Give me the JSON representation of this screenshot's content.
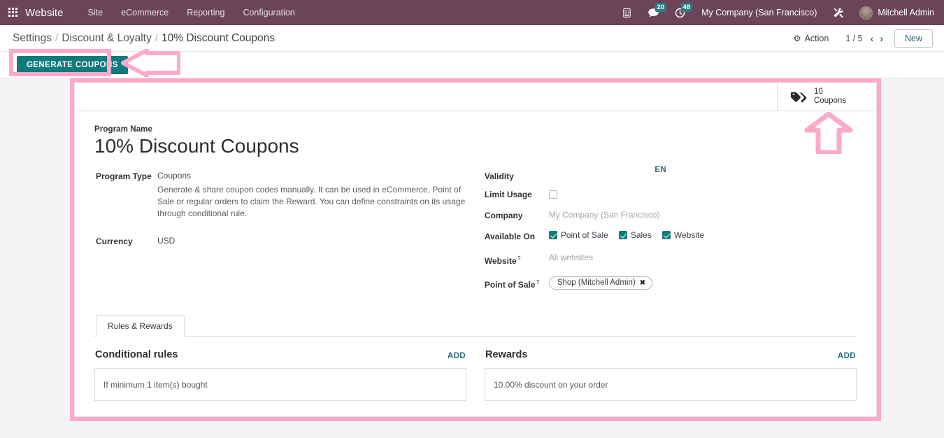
{
  "navbar": {
    "apps_icon": "apps-grid-icon",
    "brand": "Website",
    "menu": [
      {
        "label": "Site"
      },
      {
        "label": "eCommerce"
      },
      {
        "label": "Reporting"
      },
      {
        "label": "Configuration"
      }
    ],
    "icons": [
      {
        "name": "phone-icon",
        "glyph": "☎",
        "badge": ""
      },
      {
        "name": "messages-icon",
        "glyph": "💬",
        "badge": "20"
      },
      {
        "name": "activities-clock-icon",
        "glyph": "⏱",
        "badge": "48"
      }
    ],
    "company": "My Company (San Francisco)",
    "tools_icon": "tools-icon",
    "user": "Mitchell Admin"
  },
  "breadcrumb": {
    "root": "Settings",
    "sep": "/",
    "parent": "Discount & Loyalty",
    "current": "10% Discount Coupons"
  },
  "control_panel": {
    "action_label": "Action",
    "gear_icon": "gear-icon",
    "pager": "1 / 5",
    "prev_icon": "‹",
    "next_icon": "›",
    "new_label": "New"
  },
  "action_bar": {
    "generate_label": "GENERATE COUPONS"
  },
  "stat_buttons": [
    {
      "icon": "tags-icon",
      "value": "10",
      "label": "Coupons"
    }
  ],
  "form": {
    "program_name_label": "Program Name",
    "program_name": "10% Discount Coupons",
    "language_badge": "EN",
    "program_type_label": "Program Type",
    "program_type": "Coupons",
    "program_type_description": "Generate & share coupon codes manually. It can be used in eCommerce, Point of Sale or regular orders to claim the Reward. You can define constraints on its usage through conditional rule.",
    "currency_label": "Currency",
    "currency": "USD",
    "validity_label": "Validity",
    "validity": "",
    "limit_usage_label": "Limit Usage",
    "limit_usage_checked": false,
    "company_label": "Company",
    "company": "My Company (San Francisco)",
    "available_on_label": "Available On",
    "available_on": [
      {
        "label": "Point of Sale",
        "checked": true
      },
      {
        "label": "Sales",
        "checked": true
      },
      {
        "label": "Website",
        "checked": true
      }
    ],
    "website_label": "Website",
    "website_help": "?",
    "website_placeholder": "All websites",
    "pos_label": "Point of Sale",
    "pos_help": "?",
    "pos_tag": "Shop (Mitchell Admin)",
    "pos_tag_remove": "✖"
  },
  "notebook": {
    "tabs": [
      {
        "label": "Rules & Rewards",
        "active": true
      }
    ],
    "conditional_rules": {
      "title": "Conditional rules",
      "add_label": "ADD",
      "items": [
        "If minimum 1 item(s) bought"
      ]
    },
    "rewards": {
      "title": "Rewards",
      "add_label": "ADD",
      "items": [
        "10.00% discount on your order"
      ]
    }
  },
  "annotations": {
    "highlight_color": "#fbaacb",
    "generate_button_highlight": "rectangle around GENERATE COUPONS button",
    "sheet_highlight": "rectangle around form sheet",
    "arrow_left": "arrow pointing left to GENERATE COUPONS",
    "arrow_up": "arrow pointing up to Coupons stat button"
  },
  "theme": {
    "navbar_bg": "#6b4458",
    "primary": "#117a7e",
    "link": "#28697a",
    "page_bg": "#f4f4f7"
  }
}
